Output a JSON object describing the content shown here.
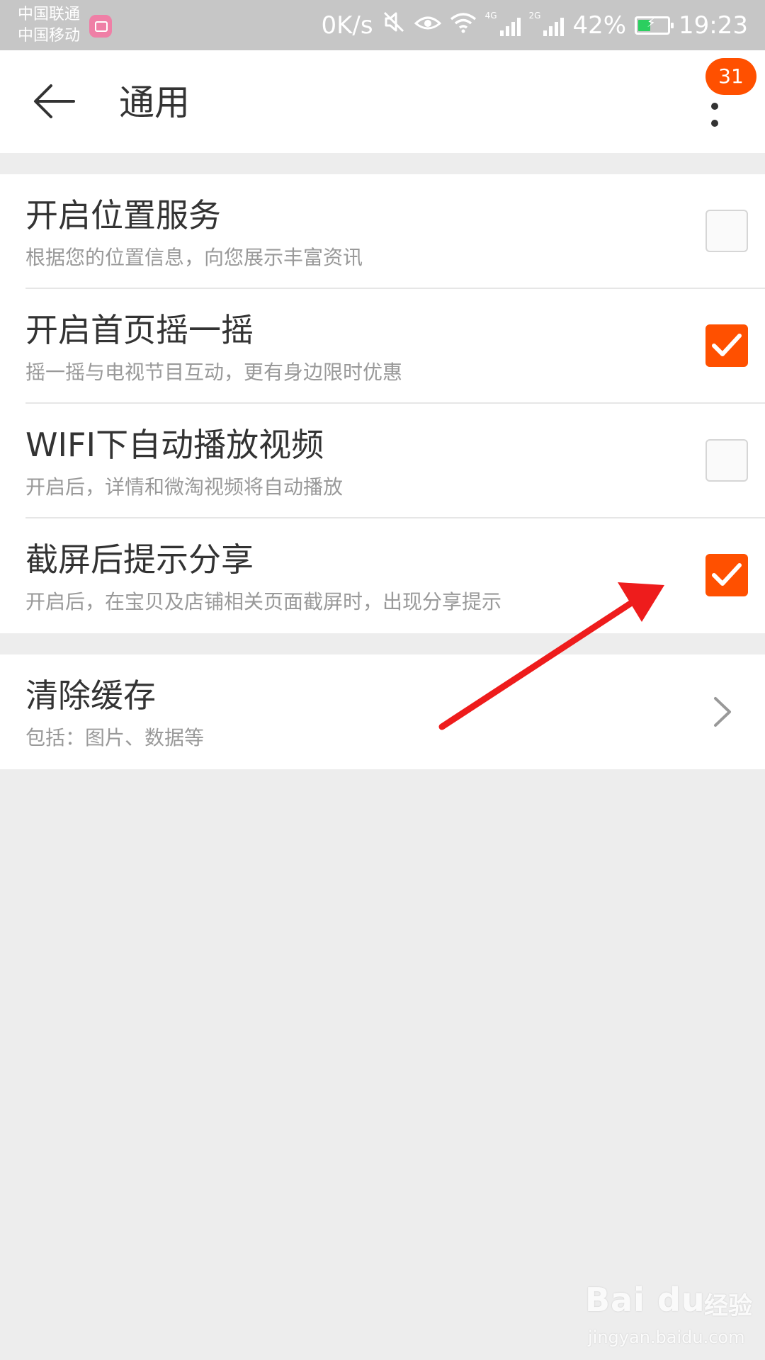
{
  "status_bar": {
    "carrier_1": "中国联通",
    "carrier_2": "中国移动",
    "net_speed": "0K/s",
    "network_1_label": "4G",
    "network_2_label": "2G",
    "battery_percent": "42%",
    "battery_level": 0.42,
    "time": "19:23",
    "icons": [
      "app-notification-icon",
      "mute-icon",
      "eye-comfort-icon",
      "wifi-icon",
      "signal-4g-icon",
      "signal-2g-icon",
      "battery-charging-icon"
    ]
  },
  "app_bar": {
    "title": "通用",
    "back_icon": "arrow-left-icon",
    "more_icon": "more-vertical-icon",
    "badge_count": "31"
  },
  "settings": [
    {
      "title": "开启位置服务",
      "subtitle": "根据您的位置信息，向您展示丰富资讯",
      "checked": false
    },
    {
      "title": "开启首页摇一摇",
      "subtitle": "摇一摇与电视节目互动，更有身边限时优惠",
      "checked": true
    },
    {
      "title": "WIFI下自动播放视频",
      "subtitle": "开启后，详情和微淘视频将自动播放",
      "checked": false
    },
    {
      "title": "截屏后提示分享",
      "subtitle": "开启后，在宝贝及店铺相关页面截屏时，出现分享提示",
      "checked": true
    }
  ],
  "cache": {
    "title": "清除缓存",
    "subtitle": "包括：图片、数据等",
    "icon": "chevron-right-icon"
  },
  "colors": {
    "accent": "#ff5000",
    "status_bar_bg": "#c6c6c6",
    "page_bg": "#ededed",
    "annotation_arrow": "#ee1c1c"
  },
  "watermark": {
    "logo": "Bai du",
    "brand": "经验",
    "url": "jingyan.baidu.com"
  }
}
